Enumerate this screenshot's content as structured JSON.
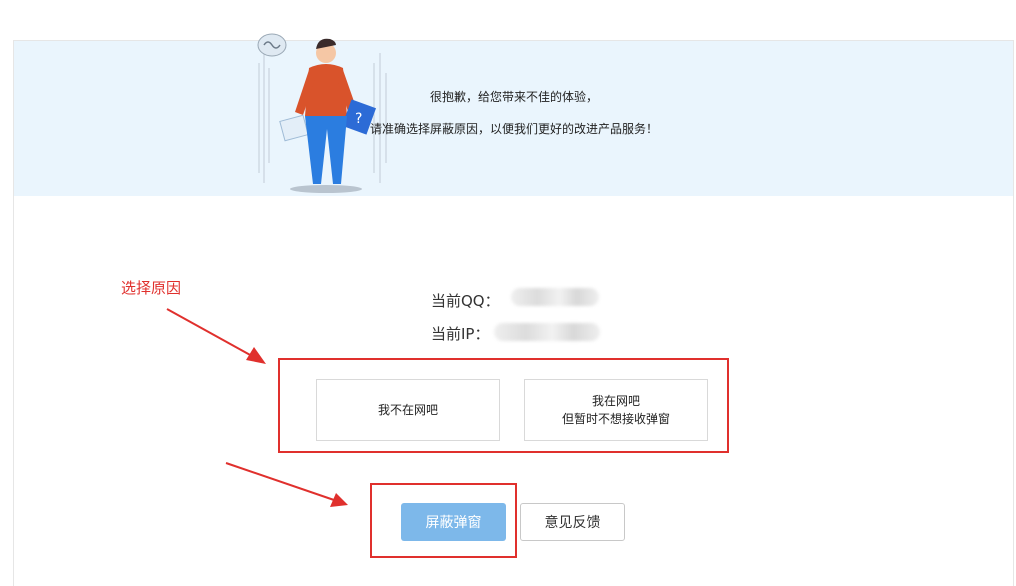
{
  "banner": {
    "line1": "很抱歉，给您带来不佳的体验，",
    "line2": "请准确选择屏蔽原因，以便我们更好的改进产品服务！"
  },
  "annotation": {
    "label": "选择原因",
    "color": "#e0302d"
  },
  "info": {
    "qq_label": "当前QQ：",
    "ip_label": "当前IP："
  },
  "reasons": [
    {
      "line1": "我不在网吧",
      "line2": ""
    },
    {
      "line1": "我在网吧",
      "line2": "但暂时不想接收弹窗"
    }
  ],
  "buttons": {
    "block_label": "屏蔽弹窗",
    "feedback_label": "意见反馈"
  },
  "colors": {
    "primary": "#7db8ea",
    "banner_bg": "#eaf5fd",
    "highlight": "#e0302d"
  }
}
